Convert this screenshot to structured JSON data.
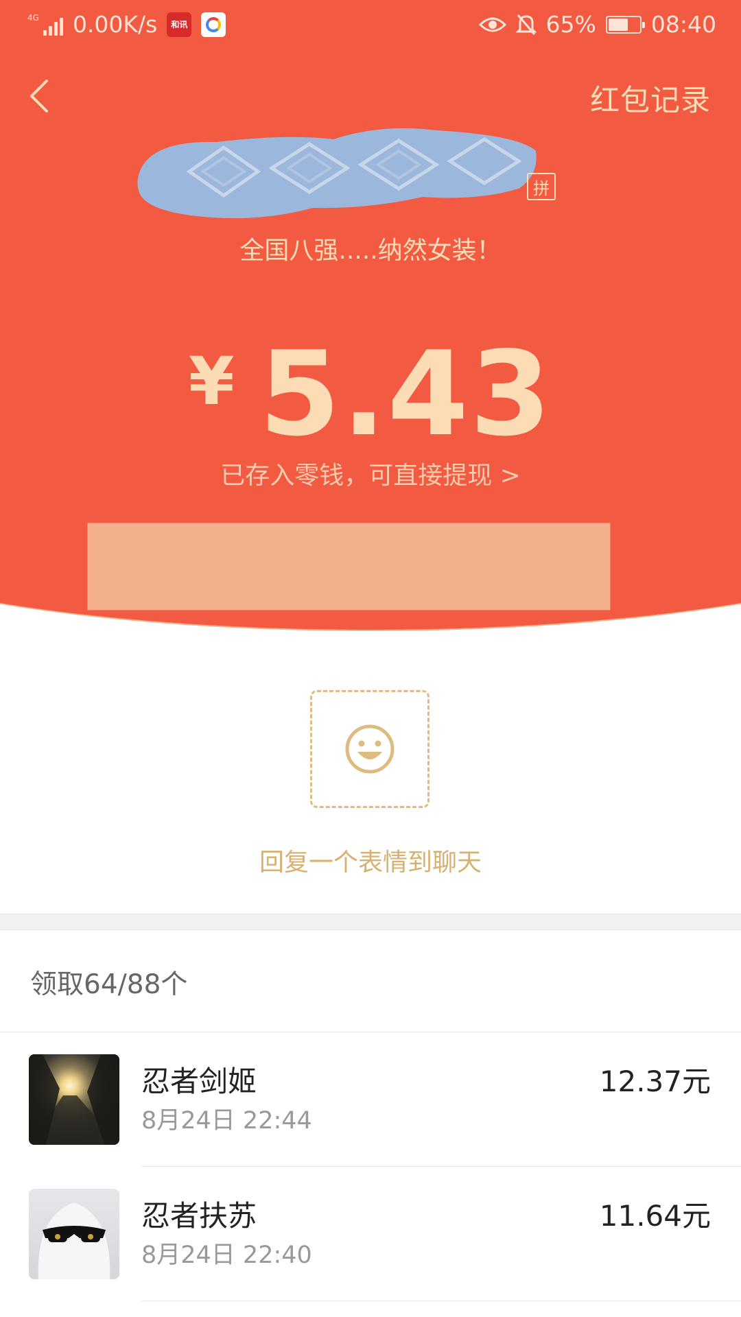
{
  "status_bar": {
    "network": "4G",
    "speed": "0.00K/s",
    "app_icon_1_text": "和讯",
    "battery": "65%",
    "battery_level": 0.65,
    "time": "08:40"
  },
  "header": {
    "records_label": "红包记录"
  },
  "packet": {
    "pinyin_badge": "拼",
    "greeting": "全国八强.....纳然女装！",
    "currency": "¥",
    "amount": "5.43",
    "saved_text": "已存入零钱，可直接提现 >"
  },
  "emoji_reply": {
    "label": "回复一个表情到聊天"
  },
  "claims": {
    "summary": "领取64/88个",
    "items": [
      {
        "name": "忍者剑姬",
        "time": "8月24日  22:44",
        "amount": "12.37元",
        "avatar": "sunset-photo"
      },
      {
        "name": "忍者扶苏",
        "time": "8月24日  22:40",
        "amount": "11.64元",
        "avatar": "ghost-sunglasses"
      }
    ]
  },
  "colors": {
    "header_red": "#f25a42",
    "gold_text": "#fbdcb4",
    "emoji_gold": "#d9b06e"
  }
}
